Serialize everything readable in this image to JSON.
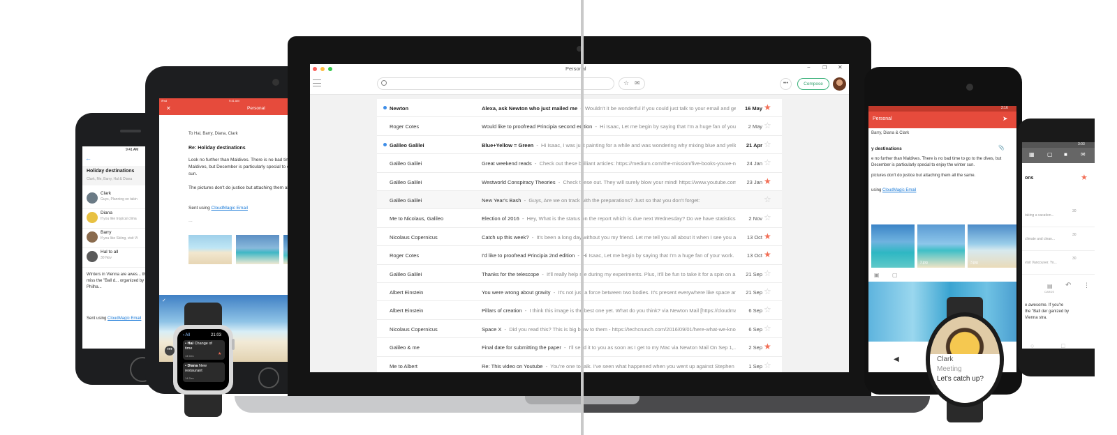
{
  "app": {
    "window_title": "Personal",
    "compose_label": "Compose",
    "emails": [
      {
        "sender": "Newton",
        "subject": "Alexa, ask Newton who just mailed me",
        "preview": "Wouldn't it be wonderful if you could just talk to your email and get t...",
        "date": "16 May",
        "unread": true,
        "starred": true
      },
      {
        "sender": "Roger Cotes",
        "subject": "Would like to proofread Principia second edition",
        "preview": "Hi Isaac, Let me begin by saying that I'm a huge fan of your w...",
        "date": "2 May",
        "unread": false,
        "starred": false
      },
      {
        "sender": "Galileo Galilei",
        "subject": "Blue+Yellow = Green",
        "preview": "Hi Isaac, I was just painting for a while and was wondering why mixing blue and yellow c...",
        "date": "21 Apr",
        "unread": true,
        "starred": false
      },
      {
        "sender": "Galileo Galilei",
        "subject": "Great weekend reads",
        "preview": "Check out these brilliant articles: https://medium.com/the-mission/five-books-youve-ne...",
        "date": "24 Jan",
        "unread": false,
        "starred": false
      },
      {
        "sender": "Galileo Galilei",
        "subject": "Westworld Conspiracy Theories",
        "preview": "Check these out. They will surely blow your mind! https://www.youtube.com/...",
        "date": "23 Jan",
        "unread": false,
        "starred": true
      },
      {
        "sender": "Galileo Galilei",
        "subject": "New Year's Bash",
        "preview": "Guys, Are we on track with the preparations? Just so that you don't forget:",
        "date": "",
        "unread": false,
        "starred": false
      },
      {
        "sender": "Me to Nicolaus, Galileo",
        "subject": "Election of 2016",
        "preview": "Hey, What is the status on the report which is due next Wednesday? Do we have statistics to...",
        "date": "2 Nov",
        "unread": false,
        "starred": false
      },
      {
        "sender": "Nicolaus Copernicus",
        "subject": "Catch up this week?",
        "preview": "It's been a long day without you my friend. Let me tell you all about it when I see you agai...",
        "date": "13 Oct",
        "unread": false,
        "starred": true
      },
      {
        "sender": "Roger Cotes",
        "subject": "I'd like to proofread Principia 2nd edition",
        "preview": "Hi Isaac, Let me begin by saying that I'm a huge fan of your work. Ha...",
        "date": "13 Oct",
        "unread": false,
        "starred": true
      },
      {
        "sender": "Galileo Galilei",
        "subject": "Thanks for the telescope",
        "preview": "It'll really help me during my experiments. Plus, It'll be fun to take it for a spin on a laz...",
        "date": "21 Sep",
        "unread": false,
        "starred": false
      },
      {
        "sender": "Albert Einstein",
        "subject": "You were wrong about gravity",
        "preview": "It's not just a force between two bodies. It's present everywhere like space and t...",
        "date": "21 Sep",
        "unread": false,
        "starred": false
      },
      {
        "sender": "Albert Einstein",
        "subject": "Pillars of creation",
        "preview": "I think this image is the best one yet. What do you think? via Newton Mail [https://cloudmagi...",
        "date": "6 Sep",
        "unread": false,
        "starred": false
      },
      {
        "sender": "Nicolaus Copernicus",
        "subject": "Space X",
        "preview": "Did you read this? This is big blow to them - https://techcrunch.com/2016/09/01/here-what-we-kno...",
        "date": "6 Sep",
        "unread": false,
        "starred": false
      },
      {
        "sender": "Galileo & me",
        "subject": "Final date for submitting the paper",
        "preview": "I'll send it to you as soon as I get to my Mac via Newton Mail On Sep 1,...",
        "date": "2 Sep",
        "unread": false,
        "starred": true
      },
      {
        "sender": "Me to Albert",
        "subject": "Re: This video on Youtube",
        "preview": "You're one to talk. I've seen what happened when you went up against Stephen Ha...",
        "date": "1 Sep",
        "unread": false,
        "starred": false
      }
    ]
  },
  "iphone": {
    "status_time": "9:41 AM",
    "thread_title": "Holiday destinations",
    "thread_people": "Clark, Me, Barry, Hal & Diana",
    "items": [
      {
        "name": "Clark",
        "preview": "Guys, Planning on takin"
      },
      {
        "name": "Diana",
        "preview": "If you like tropical clima"
      },
      {
        "name": "Barry",
        "preview": "If you like Skiing, visit Vi"
      },
      {
        "name": "Hal to all",
        "preview": "30 Nov"
      }
    ],
    "body": "Winters in Vienna are awes... there, don't miss the \"Ball d... organized by Vienna Philha...",
    "sent_using": "Sent using",
    "link": "CloudMagic Email"
  },
  "ipad": {
    "status_left": "iPad",
    "status_time": "9:41 AM",
    "folder": "Personal",
    "to_line": "To Hal, Barry, Diana, Clark",
    "subject": "Re: Holiday destinations",
    "body1": "Look no further than Maldives. There is no bad time to go to the Maldives, but December is particularly special to enjoy the winter sun.",
    "body2": "The pictures don't do justice but attaching them all the same.",
    "sent_using": "Sent using",
    "link": "CloudMagic Email",
    "ellipsis": "..."
  },
  "apple_watch": {
    "back": "All",
    "time": "21:03",
    "items": [
      {
        "name": "Hal",
        "text": "Change of time",
        "date": "14 Dec",
        "starred": true
      },
      {
        "name": "Diana",
        "text": "New restaurant",
        "date": "14 Dec",
        "starred": false
      }
    ]
  },
  "android_tablet": {
    "status_time": "2:16",
    "folder": "Personal",
    "to_line": "Barry, Diana & Clark",
    "subject": "y destinations",
    "body1": "e no further than Maldives. There is no bad time to go to the dives, but December is particularly special to enjoy the winter sun.",
    "body2": "pictures don't do justice but attaching them all the same.",
    "sent_using": "using",
    "link": "CloudMagic Email",
    "attachments": [
      "2.jpg",
      "3.jpg"
    ]
  },
  "android_phone": {
    "status_time": "3:03",
    "title_fragment": "ons",
    "items": [
      {
        "text": "taking a vacation...",
        "date": "30"
      },
      {
        "text": "climate and clean...",
        "date": "30"
      },
      {
        "text": "visit Vancouver. Yo...",
        "date": "30"
      }
    ],
    "cards_label": "CARDS",
    "body": "e awesome. If you're the \"Ball der ganized by Vienna stra."
  },
  "moto_watch": {
    "name": "Clark",
    "subject": "Meeting",
    "preview": "Let's catch up?"
  }
}
